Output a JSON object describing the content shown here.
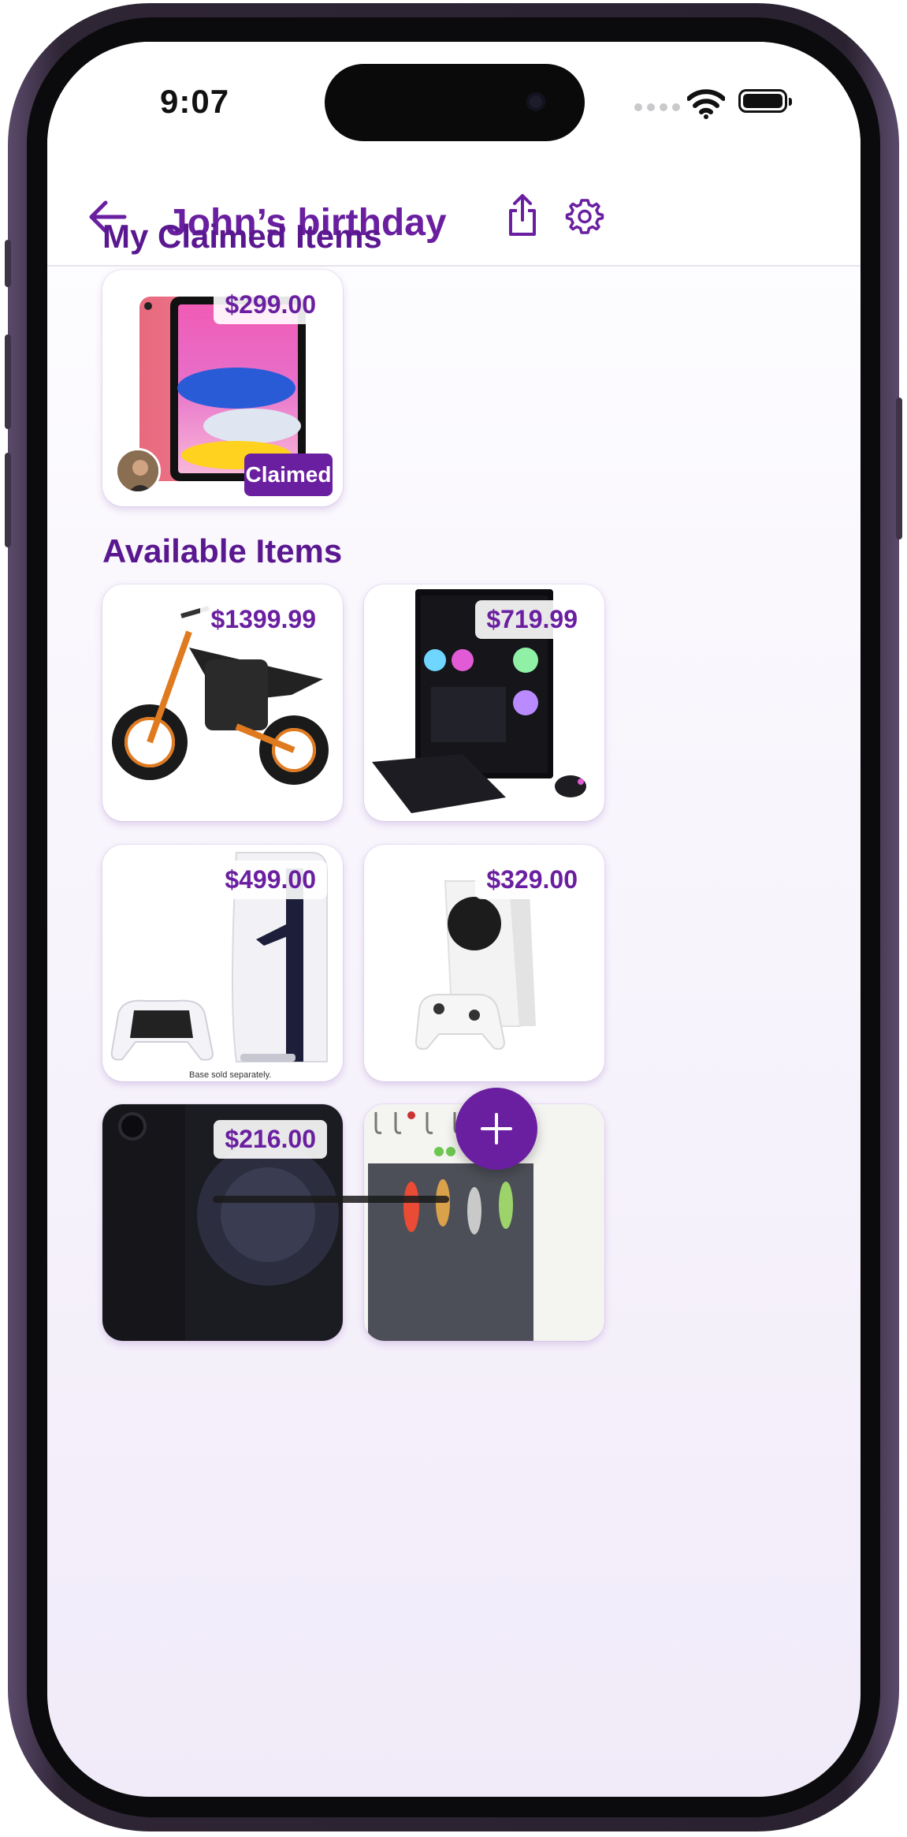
{
  "status_bar": {
    "time": "9:07"
  },
  "header": {
    "title": "John’s birthday"
  },
  "claimed_section": {
    "title": "My Claimed Items",
    "items": [
      {
        "price": "$299.00",
        "badge": "Claimed",
        "product": "iPad (pink)"
      }
    ]
  },
  "available_section": {
    "title": "Available Items",
    "items": [
      {
        "price": "$1399.99",
        "product": "Electric dirt bike"
      },
      {
        "price": "$719.99",
        "product": "Gaming PC with keyboard and mouse"
      },
      {
        "price": "$499.00",
        "product": "PlayStation 5 Slim with controller",
        "note": "Base sold separately."
      },
      {
        "price": "$329.00",
        "product": "Xbox Series S with controller"
      },
      {
        "price": "$216.00",
        "product": "iPhone (dark)"
      },
      {
        "price": "",
        "product": "Fishing lure kit"
      }
    ]
  },
  "colors": {
    "accent": "#6a1fa0",
    "title": "#5a1890",
    "background": "#f3eefa"
  },
  "icons": [
    "back-arrow-icon",
    "share-icon",
    "gear-icon",
    "plus-icon",
    "wifi-icon",
    "battery-icon"
  ]
}
